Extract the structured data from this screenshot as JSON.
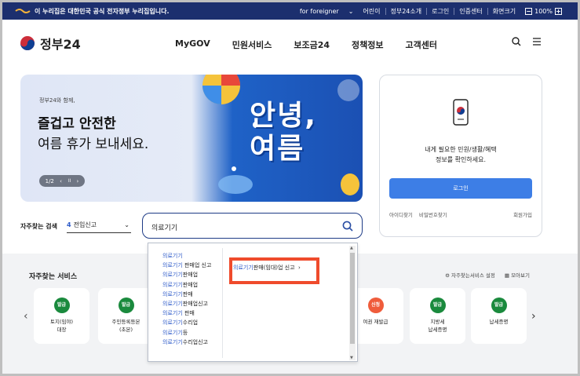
{
  "govbar": {
    "notice": "이 누리집은 대한민국 공식 전자정부 누리집입니다.",
    "foreigner": "for foreigner",
    "kids": "어린이",
    "intro": "정부24소개",
    "login": "로그인",
    "auth": "인증센터",
    "textsize": "화면크기",
    "zoom": "100%"
  },
  "header": {
    "logo": "정부24",
    "nav": [
      "MyGOV",
      "민원서비스",
      "보조금24",
      "정책정보",
      "고객센터"
    ]
  },
  "hero": {
    "small": "정부24와 함께,",
    "title1": "즐겁고 안전한",
    "title2": "여름 휴가 보내세요.",
    "pager": "1/2",
    "big1": "안녕,",
    "big2": "여름"
  },
  "login": {
    "text1": "내게 필요한 민원/생활/혜택",
    "text2": "정보를 확인하세요.",
    "button": "로그인",
    "find_id": "아이디찾기",
    "find_pw": "비밀번호찾기",
    "join": "회원가입"
  },
  "search": {
    "label": "자주찾는 검색",
    "select_num": "4",
    "select_text": "전입신고",
    "value": "의료기기"
  },
  "autocomplete": {
    "items": [
      {
        "hl": "의료기기",
        "rest": ""
      },
      {
        "hl": "의료기기",
        "rest": " 판매업 신고"
      },
      {
        "hl": "의료기기",
        "rest": "판매업"
      },
      {
        "hl": "의료기기",
        "rest": "판매업"
      },
      {
        "hl": "의료기기",
        "rest": "판매"
      },
      {
        "hl": "의료기기",
        "rest": "판매업신고"
      },
      {
        "hl": "의료기기",
        "rest": " 판매"
      },
      {
        "hl": "의료기기",
        "rest": "수리업"
      },
      {
        "hl": "의료기기",
        "rest": "등"
      },
      {
        "hl": "의료기기",
        "rest": "수리업신고"
      }
    ],
    "related_hl": "의료기기",
    "related_rest": "판매(임대)업 신고"
  },
  "services": {
    "title": "자주찾는 서비스",
    "setting": "자주찾는서비스 설정",
    "viewall": "모아보기",
    "cards": [
      {
        "badge": "발급",
        "name1": "토지(임야)",
        "name2": "대장",
        "red": false
      },
      {
        "badge": "발급",
        "name1": "주민등록등본",
        "name2": "(초본)",
        "red": false
      },
      {
        "badge": "신청",
        "name1": "여권 재발급",
        "name2": "",
        "red": true
      },
      {
        "badge": "발급",
        "name1": "지방세",
        "name2": "납세증명",
        "red": false
      },
      {
        "badge": "발급",
        "name1": "납세증명",
        "name2": "",
        "red": false
      }
    ]
  },
  "colors": {
    "navy": "#1c2f6e",
    "accent": "#2e5bc9",
    "login_button": "#3d7ee6",
    "badge_green": "#1a8a3d",
    "badge_red": "#ef5c3b",
    "highlight_box": "#ef4b2c"
  }
}
